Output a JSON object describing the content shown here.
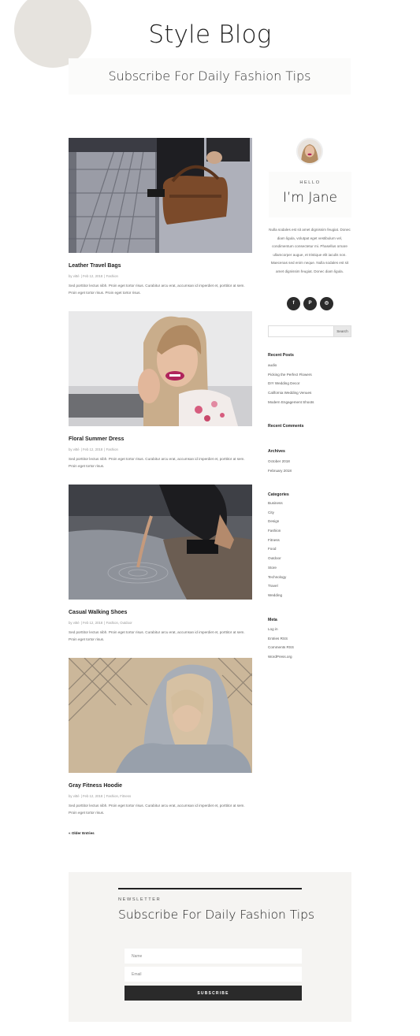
{
  "site": {
    "title": "Style Blog",
    "subscribe_banner": "Subscribe For Daily Fashion Tips"
  },
  "posts": [
    {
      "title": "Leather Travel Bags",
      "author": "by vitté",
      "date": "Feb 12, 2018",
      "categories": "Fashion",
      "excerpt": "Sed porttitor lectus nibh. Proin eget tortor risus. Curabitur arcu erat, accumsan id imperdiet et, porttitor at sem. Proin eget tortor risus. Proin eget tortor risus."
    },
    {
      "title": "Floral Summer Dress",
      "author": "by vitté",
      "date": "Feb 12, 2018",
      "categories": "Fashion",
      "excerpt": "Sed porttitor lectus nibh. Proin eget tortor risus. Curabitur arcu erat, accumsan id imperdiet et, porttitor at sem. Proin eget tortor risus."
    },
    {
      "title": "Casual Walking Shoes",
      "author": "by vitté",
      "date": "Feb 12, 2018",
      "categories": "Fashion, Outdoor",
      "excerpt": "Sed porttitor lectus nibh. Proin eget tortor risus. Curabitur arcu erat, accumsan id imperdiet et, porttitor at sem. Proin eget tortor risus."
    },
    {
      "title": "Gray Fitness Hoodie",
      "author": "by vitté",
      "date": "Feb 12, 2018",
      "categories": "Fashion, Fitness",
      "excerpt": "Sed porttitor lectus nibh. Proin eget tortor risus. Curabitur arcu erat, accumsan id imperdiet et, porttitor at sem. Proin eget tortor risus."
    }
  ],
  "older_entries": "« Older Entries",
  "about": {
    "hello": "HELLO",
    "name": "I’m Jane",
    "bio": "Nulla sodales est sit amet dignissim feugiat. Donec diam ligula, volutpat eget vestibulum vel, condimentum consectetur mi. Phasellus ornare ullamcorper augue, et tristique elit iaculis non. Maecenas sed enim neque. Nulla sodales est sit amet dignissim feugiat. Donec diam ligula."
  },
  "social": [
    {
      "icon": "facebook-icon",
      "glyph": "f"
    },
    {
      "icon": "pinterest-icon",
      "glyph": "P"
    },
    {
      "icon": "instagram-icon",
      "glyph": "◎"
    }
  ],
  "search": {
    "placeholder": "",
    "button": "Search"
  },
  "recent_posts": {
    "title": "Recent Posts",
    "items": [
      "audio",
      "Picking the Perfect Flowers",
      "DIY Wedding Decor",
      "California Wedding Venues",
      "Modern Engagement Shoots"
    ]
  },
  "recent_comments": {
    "title": "Recent Comments"
  },
  "archives": {
    "title": "Archives",
    "items": [
      "October 2018",
      "February 2018"
    ]
  },
  "categories": {
    "title": "Categories",
    "items": [
      "Business",
      "City",
      "Design",
      "Fashion",
      "Fitness",
      "Food",
      "Outdoor",
      "Store",
      "Technology",
      "Travel",
      "Wedding"
    ]
  },
  "meta": {
    "title": "Meta",
    "items": [
      "Log in",
      "Entries RSS",
      "Comments RSS",
      "WordPress.org"
    ]
  },
  "newsletter": {
    "label": "NEWSLETTER",
    "title": "Subscribe For Daily Fashion Tips",
    "name_placeholder": "Name",
    "email_placeholder": "Email",
    "submit": "SUBSCRIBE"
  }
}
